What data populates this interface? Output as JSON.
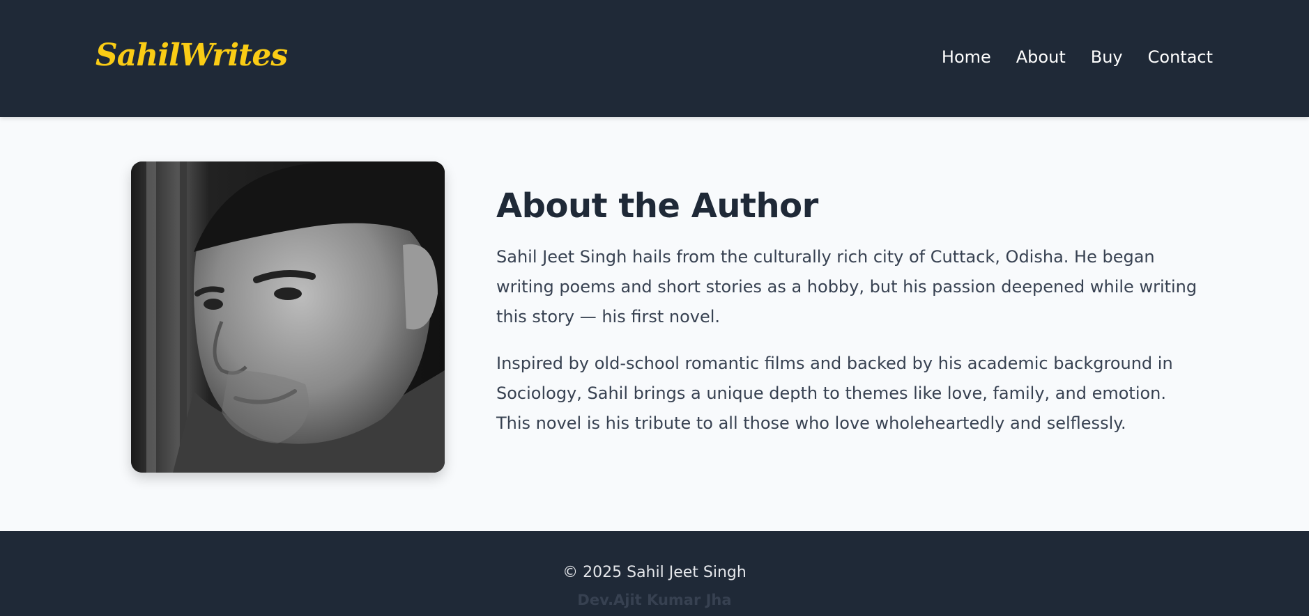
{
  "header": {
    "logo": "SahilWrites",
    "nav": [
      "Home",
      "About",
      "Buy",
      "Contact"
    ]
  },
  "about": {
    "heading": "About the Author",
    "paragraphs": [
      "Sahil Jeet Singh hails from the culturally rich city of Cuttack, Odisha. He began writing poems and short stories as a hobby, but his passion deepened while writing this story — his first novel.",
      "Inspired by old-school romantic films and backed by his academic background in Sociology, Sahil brings a unique depth to themes like love, family, and emotion. This novel is his tribute to all those who love wholeheartedly and selflessly."
    ]
  },
  "footer": {
    "copyright": "© 2025 Sahil Jeet Singh",
    "developer": "Dev.Ajit Kumar Jha"
  },
  "colors": {
    "nav_bg": "#1f2937",
    "logo": "#facc15",
    "page_bg": "#f8fafc",
    "heading": "#1f2937",
    "body_text": "#374151"
  }
}
